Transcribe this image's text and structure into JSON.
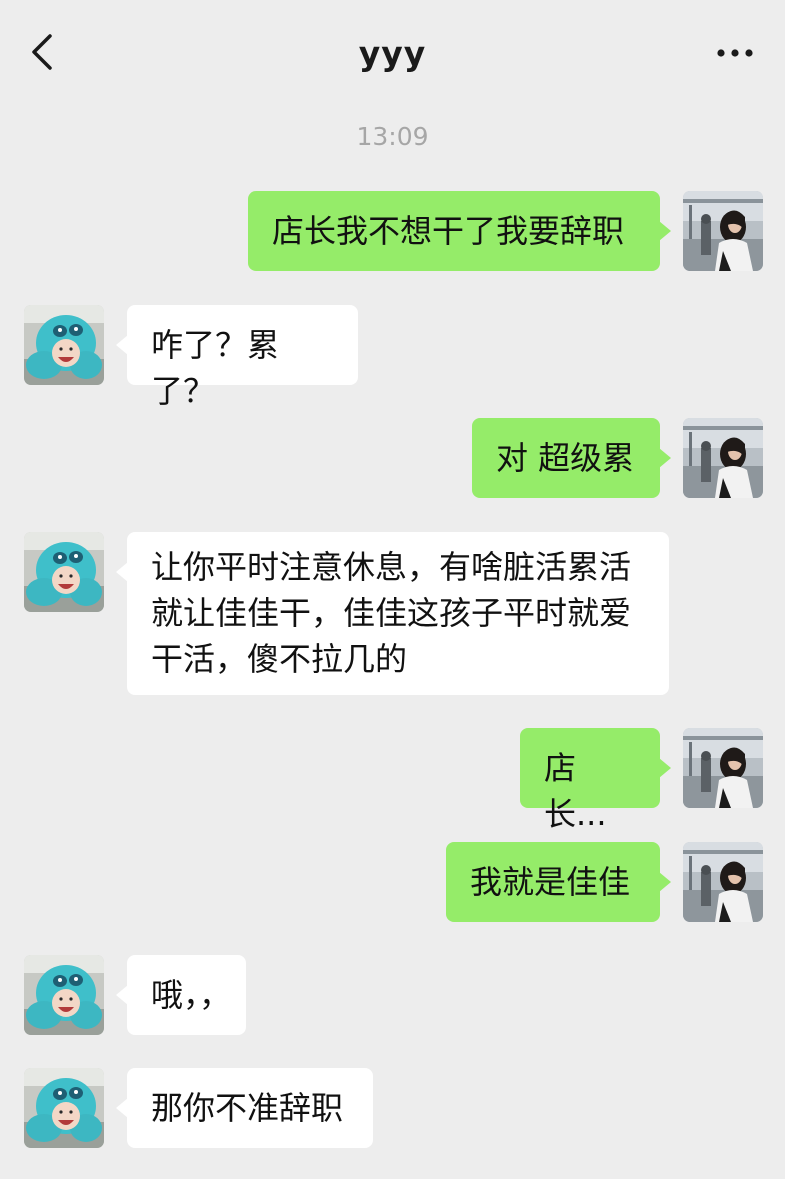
{
  "header": {
    "back_icon": "chevron-left-icon",
    "title": "yyy",
    "more_icon": "more-dots-icon"
  },
  "timestamp": "13:09",
  "colors": {
    "background": "#ededed",
    "sent_bubble": "#95ec69",
    "received_bubble": "#ffffff",
    "timestamp_text": "#a6a6a6"
  },
  "messages": [
    {
      "sender": "me",
      "text": "店长我不想干了我要辞职",
      "avatar": "girl-photo-avatar"
    },
    {
      "sender": "other",
      "text": "咋了？累了？",
      "avatar": "blue-hood-kid-avatar"
    },
    {
      "sender": "me",
      "text": "对 超级累",
      "avatar": "girl-photo-avatar"
    },
    {
      "sender": "other",
      "text": "让你平时注意休息，有啥脏活累活就让佳佳干，佳佳这孩子平时就爱干活，傻不拉几的",
      "avatar": "blue-hood-kid-avatar"
    },
    {
      "sender": "me",
      "text": "店长...",
      "avatar": "girl-photo-avatar"
    },
    {
      "sender": "me",
      "text": "我就是佳佳",
      "avatar": "girl-photo-avatar"
    },
    {
      "sender": "other",
      "text": "哦，，",
      "avatar": "blue-hood-kid-avatar"
    },
    {
      "sender": "other",
      "text": "那你不准辞职",
      "avatar": "blue-hood-kid-avatar"
    }
  ]
}
